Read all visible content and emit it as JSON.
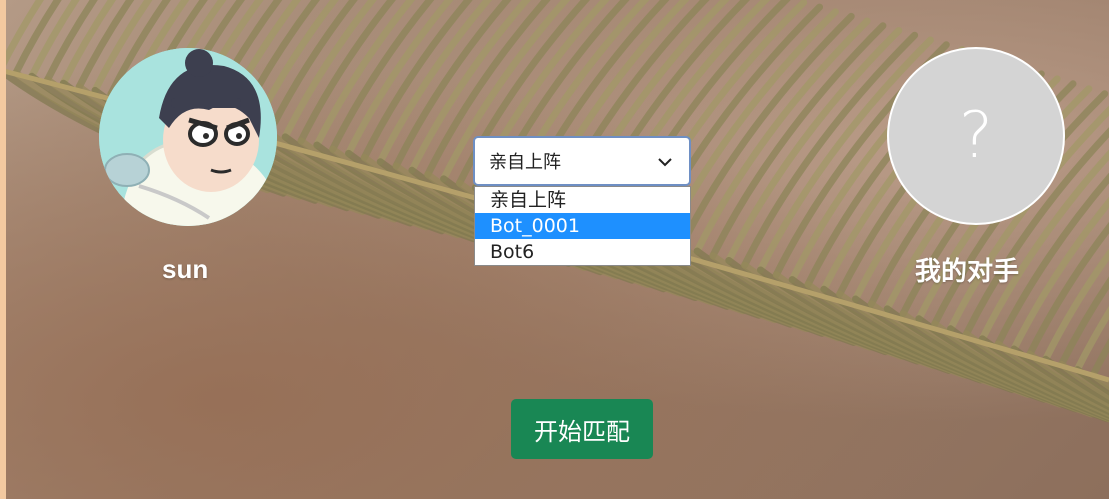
{
  "players": {
    "me": {
      "name": "sun"
    },
    "opponent": {
      "name": "我的对手",
      "placeholder_glyph": "?"
    }
  },
  "bot_select": {
    "selected": "亲自上阵",
    "options": [
      "亲自上阵",
      "Bot_0001",
      "Bot6"
    ],
    "highlighted_option": "Bot_0001"
  },
  "actions": {
    "start_match": "开始匹配"
  },
  "colors": {
    "button": "#198754",
    "highlight": "#1e90ff",
    "opponent_avatar": "#d4d4d4",
    "edge_strip": "#f3c9a0"
  },
  "icons": {
    "select_chevron": "chevron-down-icon"
  }
}
